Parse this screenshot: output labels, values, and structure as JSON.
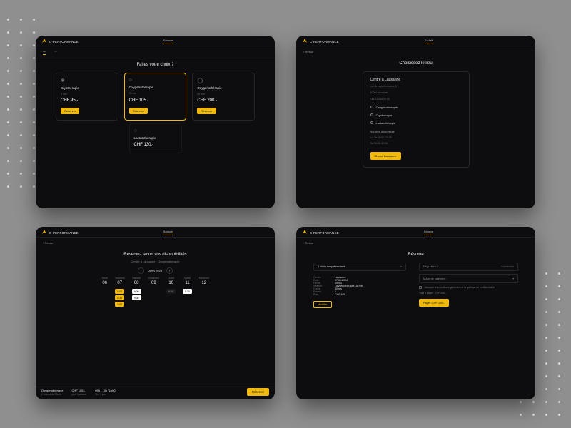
{
  "brand": "C-PERFORMANCE",
  "accent": "#f0b90b",
  "screens": {
    "s1": {
      "center_tab": "Séance",
      "nav": {
        "active": "—",
        "other": "—"
      },
      "title": "Faites votre choix ?",
      "cards": [
        {
          "icon": "❄",
          "name": "Cryothérapie",
          "sub": "3 min",
          "price": "CHF 95.-",
          "cta": "Réserver"
        },
        {
          "icon": "○",
          "name": "Oxygénothérapie",
          "sub": "30 min",
          "price": "CHF 105.-",
          "cta": "Réserver",
          "highlight": true
        },
        {
          "icon": "◯",
          "name": "Oxygénothérapie",
          "sub": "60 min",
          "price": "CHF 200.-",
          "cta": "Réserver"
        }
      ],
      "card4": {
        "icon": "◌",
        "name": "Lactatothérapie",
        "sub": "",
        "price": "CHF 130.-"
      }
    },
    "s2": {
      "center_tab": "Forfait",
      "back": "Retour",
      "title": "Choisissez le lieu",
      "location": {
        "name": "Centre à Lausanne",
        "addr1": "rue de la performance 5",
        "addr2": "1000 Lausanne",
        "phone": "+41 21 000 00 00",
        "services": [
          "Oxygénothérapie",
          "Cryothérapie",
          "Lactatothérapie"
        ],
        "hours_label": "Horaires d'ouverture",
        "hours1": "Lu–Ve 08:00–20:00",
        "hours2": "Sa 09:00–17:00",
        "cta": "Choisir Lausanne"
      }
    },
    "s3": {
      "center_tab": "Séance",
      "back": "Retour",
      "title": "Réservez selon vos disponibilités",
      "subtitle": "Centre à Lausanne · Oxygénothérapie",
      "month": "JUIN 2024",
      "days": [
        {
          "label": "Jeudi",
          "num": "06",
          "slots": []
        },
        {
          "label": "Vendredi",
          "num": "07",
          "slots": [
            {
              "t": "8:00",
              "k": "sel"
            },
            {
              "t": "8:30",
              "k": "sel"
            },
            {
              "t": "9:00",
              "k": "sel"
            }
          ]
        },
        {
          "label": "Samedi",
          "num": "08",
          "slots": [
            {
              "t": "9:00",
              "k": "open"
            },
            {
              "t": "9:30",
              "k": "open"
            }
          ]
        },
        {
          "label": "Dimanche",
          "num": "09",
          "slots": []
        },
        {
          "label": "Lundi",
          "num": "10",
          "slots": [
            {
              "t": "8:00",
              "k": ""
            }
          ]
        },
        {
          "label": "Mardi",
          "num": "11",
          "slots": [
            {
              "t": "8:30",
              "k": "open"
            }
          ]
        },
        {
          "label": "Mercredi",
          "num": "12",
          "slots": []
        }
      ],
      "footer": {
        "service_label": "Oxygénothérapie",
        "service_detail": "1 séance de 30min",
        "price_label": "CHF 105.-",
        "price_detail": "pour 1 séance",
        "slot_label": "09h - 10h (1h00)",
        "slot_detail": "Ven 7 juin",
        "cta": "Réserver"
      }
    },
    "s4": {
      "center_tab": "Séance",
      "back": "Retour",
      "title": "Résumé",
      "pill": "1 choix supplémentaire",
      "pill_x": "×",
      "details": [
        {
          "k": "Centre",
          "v": "Lausanne"
        },
        {
          "k": "Date",
          "v": "07.06.2024"
        },
        {
          "k": "Heure",
          "v": "09h00"
        },
        {
          "k": "Séance",
          "v": "Oxygénothérapie, 30 min"
        },
        {
          "k": "Durée",
          "v": "30min"
        },
        {
          "k": "Places",
          "v": "1"
        },
        {
          "k": "Prix",
          "v": "CHF 105.-"
        }
      ],
      "modify": "Modifier",
      "form": {
        "login_label": "Déjà client ?",
        "login_link": "Connexion",
        "field_payment": "Mode de paiement",
        "terms": "J'accepte les conditions générales et la politique de confidentialité",
        "price_line": "Total à payer : CHF 105.-",
        "cta": "Payer CHF 105.-"
      }
    }
  }
}
